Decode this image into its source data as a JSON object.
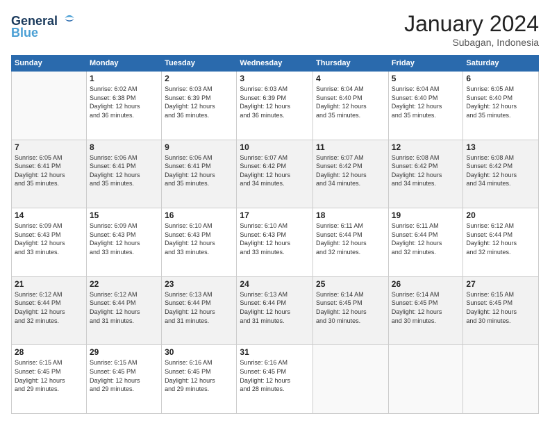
{
  "header": {
    "logo_line1": "General",
    "logo_line2": "Blue",
    "month_title": "January 2024",
    "subtitle": "Subagan, Indonesia"
  },
  "weekdays": [
    "Sunday",
    "Monday",
    "Tuesday",
    "Wednesday",
    "Thursday",
    "Friday",
    "Saturday"
  ],
  "weeks": [
    [
      {
        "day": "",
        "info": ""
      },
      {
        "day": "1",
        "info": "Sunrise: 6:02 AM\nSunset: 6:38 PM\nDaylight: 12 hours\nand 36 minutes."
      },
      {
        "day": "2",
        "info": "Sunrise: 6:03 AM\nSunset: 6:39 PM\nDaylight: 12 hours\nand 36 minutes."
      },
      {
        "day": "3",
        "info": "Sunrise: 6:03 AM\nSunset: 6:39 PM\nDaylight: 12 hours\nand 36 minutes."
      },
      {
        "day": "4",
        "info": "Sunrise: 6:04 AM\nSunset: 6:40 PM\nDaylight: 12 hours\nand 35 minutes."
      },
      {
        "day": "5",
        "info": "Sunrise: 6:04 AM\nSunset: 6:40 PM\nDaylight: 12 hours\nand 35 minutes."
      },
      {
        "day": "6",
        "info": "Sunrise: 6:05 AM\nSunset: 6:40 PM\nDaylight: 12 hours\nand 35 minutes."
      }
    ],
    [
      {
        "day": "7",
        "info": "Sunrise: 6:05 AM\nSunset: 6:41 PM\nDaylight: 12 hours\nand 35 minutes."
      },
      {
        "day": "8",
        "info": "Sunrise: 6:06 AM\nSunset: 6:41 PM\nDaylight: 12 hours\nand 35 minutes."
      },
      {
        "day": "9",
        "info": "Sunrise: 6:06 AM\nSunset: 6:41 PM\nDaylight: 12 hours\nand 35 minutes."
      },
      {
        "day": "10",
        "info": "Sunrise: 6:07 AM\nSunset: 6:42 PM\nDaylight: 12 hours\nand 34 minutes."
      },
      {
        "day": "11",
        "info": "Sunrise: 6:07 AM\nSunset: 6:42 PM\nDaylight: 12 hours\nand 34 minutes."
      },
      {
        "day": "12",
        "info": "Sunrise: 6:08 AM\nSunset: 6:42 PM\nDaylight: 12 hours\nand 34 minutes."
      },
      {
        "day": "13",
        "info": "Sunrise: 6:08 AM\nSunset: 6:42 PM\nDaylight: 12 hours\nand 34 minutes."
      }
    ],
    [
      {
        "day": "14",
        "info": "Sunrise: 6:09 AM\nSunset: 6:43 PM\nDaylight: 12 hours\nand 33 minutes."
      },
      {
        "day": "15",
        "info": "Sunrise: 6:09 AM\nSunset: 6:43 PM\nDaylight: 12 hours\nand 33 minutes."
      },
      {
        "day": "16",
        "info": "Sunrise: 6:10 AM\nSunset: 6:43 PM\nDaylight: 12 hours\nand 33 minutes."
      },
      {
        "day": "17",
        "info": "Sunrise: 6:10 AM\nSunset: 6:43 PM\nDaylight: 12 hours\nand 33 minutes."
      },
      {
        "day": "18",
        "info": "Sunrise: 6:11 AM\nSunset: 6:44 PM\nDaylight: 12 hours\nand 32 minutes."
      },
      {
        "day": "19",
        "info": "Sunrise: 6:11 AM\nSunset: 6:44 PM\nDaylight: 12 hours\nand 32 minutes."
      },
      {
        "day": "20",
        "info": "Sunrise: 6:12 AM\nSunset: 6:44 PM\nDaylight: 12 hours\nand 32 minutes."
      }
    ],
    [
      {
        "day": "21",
        "info": "Sunrise: 6:12 AM\nSunset: 6:44 PM\nDaylight: 12 hours\nand 32 minutes."
      },
      {
        "day": "22",
        "info": "Sunrise: 6:12 AM\nSunset: 6:44 PM\nDaylight: 12 hours\nand 31 minutes."
      },
      {
        "day": "23",
        "info": "Sunrise: 6:13 AM\nSunset: 6:44 PM\nDaylight: 12 hours\nand 31 minutes."
      },
      {
        "day": "24",
        "info": "Sunrise: 6:13 AM\nSunset: 6:44 PM\nDaylight: 12 hours\nand 31 minutes."
      },
      {
        "day": "25",
        "info": "Sunrise: 6:14 AM\nSunset: 6:45 PM\nDaylight: 12 hours\nand 30 minutes."
      },
      {
        "day": "26",
        "info": "Sunrise: 6:14 AM\nSunset: 6:45 PM\nDaylight: 12 hours\nand 30 minutes."
      },
      {
        "day": "27",
        "info": "Sunrise: 6:15 AM\nSunset: 6:45 PM\nDaylight: 12 hours\nand 30 minutes."
      }
    ],
    [
      {
        "day": "28",
        "info": "Sunrise: 6:15 AM\nSunset: 6:45 PM\nDaylight: 12 hours\nand 29 minutes."
      },
      {
        "day": "29",
        "info": "Sunrise: 6:15 AM\nSunset: 6:45 PM\nDaylight: 12 hours\nand 29 minutes."
      },
      {
        "day": "30",
        "info": "Sunrise: 6:16 AM\nSunset: 6:45 PM\nDaylight: 12 hours\nand 29 minutes."
      },
      {
        "day": "31",
        "info": "Sunrise: 6:16 AM\nSunset: 6:45 PM\nDaylight: 12 hours\nand 28 minutes."
      },
      {
        "day": "",
        "info": ""
      },
      {
        "day": "",
        "info": ""
      },
      {
        "day": "",
        "info": ""
      }
    ]
  ]
}
